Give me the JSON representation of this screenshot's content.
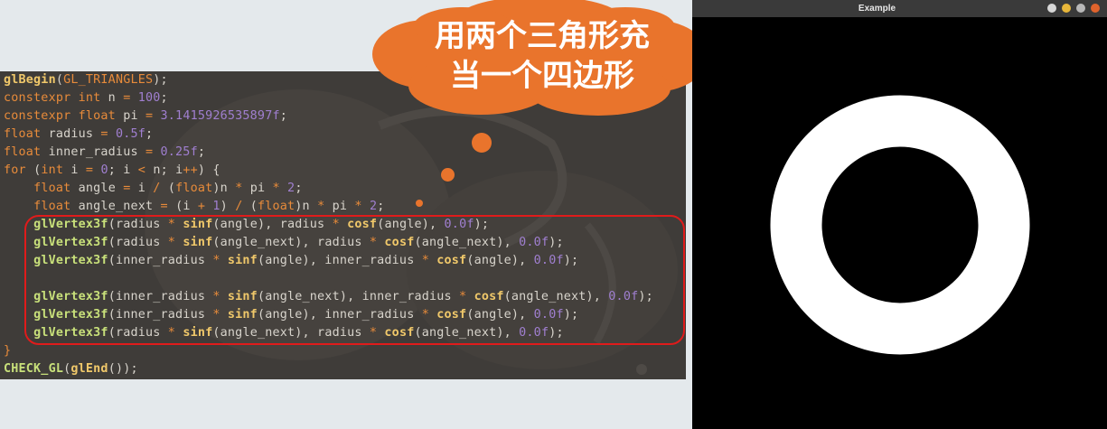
{
  "code": {
    "lines": [
      [
        [
          "fn",
          "glBegin"
        ],
        [
          "plain",
          "("
        ],
        [
          "kw",
          "GL_TRIANGLES"
        ],
        [
          "plain",
          ");"
        ]
      ],
      [
        [
          "kw",
          "constexpr int "
        ],
        [
          "plain",
          "n "
        ],
        [
          "op",
          "= "
        ],
        [
          "num",
          "100"
        ],
        [
          "plain",
          ";"
        ]
      ],
      [
        [
          "kw",
          "constexpr float "
        ],
        [
          "plain",
          "pi "
        ],
        [
          "op",
          "= "
        ],
        [
          "num",
          "3.1415926535897f"
        ],
        [
          "plain",
          ";"
        ]
      ],
      [
        [
          "kw",
          "float "
        ],
        [
          "plain",
          "radius "
        ],
        [
          "op",
          "= "
        ],
        [
          "num",
          "0.5f"
        ],
        [
          "plain",
          ";"
        ]
      ],
      [
        [
          "kw",
          "float "
        ],
        [
          "plain",
          "inner_radius "
        ],
        [
          "op",
          "= "
        ],
        [
          "num",
          "0.25f"
        ],
        [
          "plain",
          ";"
        ]
      ],
      [
        [
          "kw",
          "for "
        ],
        [
          "plain",
          "("
        ],
        [
          "kw",
          "int "
        ],
        [
          "plain",
          "i "
        ],
        [
          "op",
          "= "
        ],
        [
          "num",
          "0"
        ],
        [
          "plain",
          "; i "
        ],
        [
          "op",
          "< "
        ],
        [
          "plain",
          "n; i"
        ],
        [
          "op",
          "++"
        ],
        [
          "plain",
          ") {"
        ]
      ],
      [
        [
          "plain",
          "    "
        ],
        [
          "kw",
          "float "
        ],
        [
          "plain",
          "angle "
        ],
        [
          "op",
          "= "
        ],
        [
          "plain",
          "i "
        ],
        [
          "op",
          "/ "
        ],
        [
          "plain",
          "("
        ],
        [
          "kw",
          "float"
        ],
        [
          "plain",
          ")n "
        ],
        [
          "op",
          "* "
        ],
        [
          "plain",
          "pi "
        ],
        [
          "op",
          "* "
        ],
        [
          "num",
          "2"
        ],
        [
          "plain",
          ";"
        ]
      ],
      [
        [
          "plain",
          "    "
        ],
        [
          "kw",
          "float "
        ],
        [
          "plain",
          "angle_next "
        ],
        [
          "op",
          "= "
        ],
        [
          "plain",
          "(i "
        ],
        [
          "op",
          "+ "
        ],
        [
          "num",
          "1"
        ],
        [
          "plain",
          ") "
        ],
        [
          "op",
          "/ "
        ],
        [
          "plain",
          "("
        ],
        [
          "kw",
          "float"
        ],
        [
          "plain",
          ")n "
        ],
        [
          "op",
          "* "
        ],
        [
          "plain",
          "pi "
        ],
        [
          "op",
          "* "
        ],
        [
          "num",
          "2"
        ],
        [
          "plain",
          ";"
        ]
      ],
      [
        [
          "plain",
          "    "
        ],
        [
          "fnw",
          "glVertex3f"
        ],
        [
          "plain",
          "(radius "
        ],
        [
          "op",
          "* "
        ],
        [
          "fn",
          "sinf"
        ],
        [
          "plain",
          "(angle), radius "
        ],
        [
          "op",
          "* "
        ],
        [
          "fn",
          "cosf"
        ],
        [
          "plain",
          "(angle), "
        ],
        [
          "num",
          "0.0f"
        ],
        [
          "plain",
          ");"
        ]
      ],
      [
        [
          "plain",
          "    "
        ],
        [
          "fnw",
          "glVertex3f"
        ],
        [
          "plain",
          "(radius "
        ],
        [
          "op",
          "* "
        ],
        [
          "fn",
          "sinf"
        ],
        [
          "plain",
          "(angle_next), radius "
        ],
        [
          "op",
          "* "
        ],
        [
          "fn",
          "cosf"
        ],
        [
          "plain",
          "(angle_next), "
        ],
        [
          "num",
          "0.0f"
        ],
        [
          "plain",
          ");"
        ]
      ],
      [
        [
          "plain",
          "    "
        ],
        [
          "fnw",
          "glVertex3f"
        ],
        [
          "plain",
          "(inner_radius "
        ],
        [
          "op",
          "* "
        ],
        [
          "fn",
          "sinf"
        ],
        [
          "plain",
          "(angle), inner_radius "
        ],
        [
          "op",
          "* "
        ],
        [
          "fn",
          "cosf"
        ],
        [
          "plain",
          "(angle), "
        ],
        [
          "num",
          "0.0f"
        ],
        [
          "plain",
          ");"
        ]
      ],
      [
        [
          "plain",
          ""
        ]
      ],
      [
        [
          "plain",
          "    "
        ],
        [
          "fnw",
          "glVertex3f"
        ],
        [
          "plain",
          "(inner_radius "
        ],
        [
          "op",
          "* "
        ],
        [
          "fn",
          "sinf"
        ],
        [
          "plain",
          "(angle_next), inner_radius "
        ],
        [
          "op",
          "* "
        ],
        [
          "fn",
          "cosf"
        ],
        [
          "plain",
          "(angle_next), "
        ],
        [
          "num",
          "0.0f"
        ],
        [
          "plain",
          ");"
        ]
      ],
      [
        [
          "plain",
          "    "
        ],
        [
          "fnw",
          "glVertex3f"
        ],
        [
          "plain",
          "(inner_radius "
        ],
        [
          "op",
          "* "
        ],
        [
          "fn",
          "sinf"
        ],
        [
          "plain",
          "(angle), inner_radius "
        ],
        [
          "op",
          "* "
        ],
        [
          "fn",
          "cosf"
        ],
        [
          "plain",
          "(angle), "
        ],
        [
          "num",
          "0.0f"
        ],
        [
          "plain",
          ");"
        ]
      ],
      [
        [
          "plain",
          "    "
        ],
        [
          "fnw",
          "glVertex3f"
        ],
        [
          "plain",
          "(radius "
        ],
        [
          "op",
          "* "
        ],
        [
          "fn",
          "sinf"
        ],
        [
          "plain",
          "(angle_next), radius "
        ],
        [
          "op",
          "* "
        ],
        [
          "fn",
          "cosf"
        ],
        [
          "plain",
          "(angle_next), "
        ],
        [
          "num",
          "0.0f"
        ],
        [
          "plain",
          ");"
        ]
      ],
      [
        [
          "kw",
          "}"
        ]
      ],
      [
        [
          "fnw",
          "CHECK_GL"
        ],
        [
          "plain",
          "("
        ],
        [
          "fn",
          "glEnd"
        ],
        [
          "plain",
          "());"
        ]
      ]
    ]
  },
  "callout": {
    "line1": "用两个三角形充",
    "line2": "当一个四边形"
  },
  "window": {
    "title": "Example",
    "buttons": [
      {
        "name": "up-icon",
        "color": "#d8d8d8"
      },
      {
        "name": "minimize-button",
        "color": "#e8b73a"
      },
      {
        "name": "maximize-button",
        "color": "#b8b8b8"
      },
      {
        "name": "close-button",
        "color": "#e0632c"
      }
    ]
  },
  "colors": {
    "cloud": "#e9742c",
    "highlight": "#e01b1b",
    "ring": "#ffffff"
  }
}
